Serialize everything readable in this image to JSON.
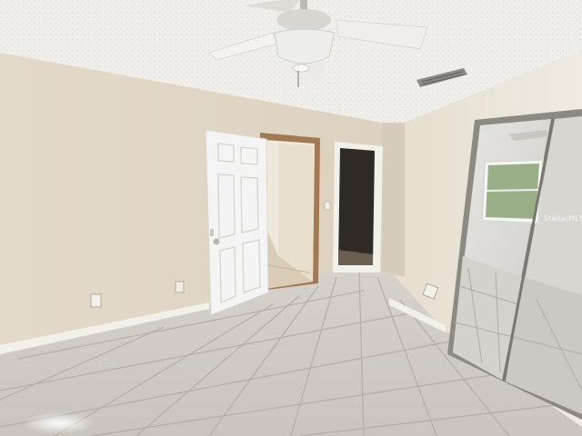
{
  "photo": {
    "watermark_text": "StellarMLS",
    "colors": {
      "ceiling": "#eeede9",
      "wall_left": "#e3d9c9",
      "wall_back": "#ddd3c2",
      "wall_right": "#e9e3d6",
      "floor_tile": "#cfcbc4",
      "grout": "#b1aca4",
      "door": "#f4f4f4",
      "door_trim": "#a07a52",
      "baseboard": "#f2f0ea",
      "mirror_frame": "#8d8a84",
      "fan_body": "#ededeb"
    }
  }
}
